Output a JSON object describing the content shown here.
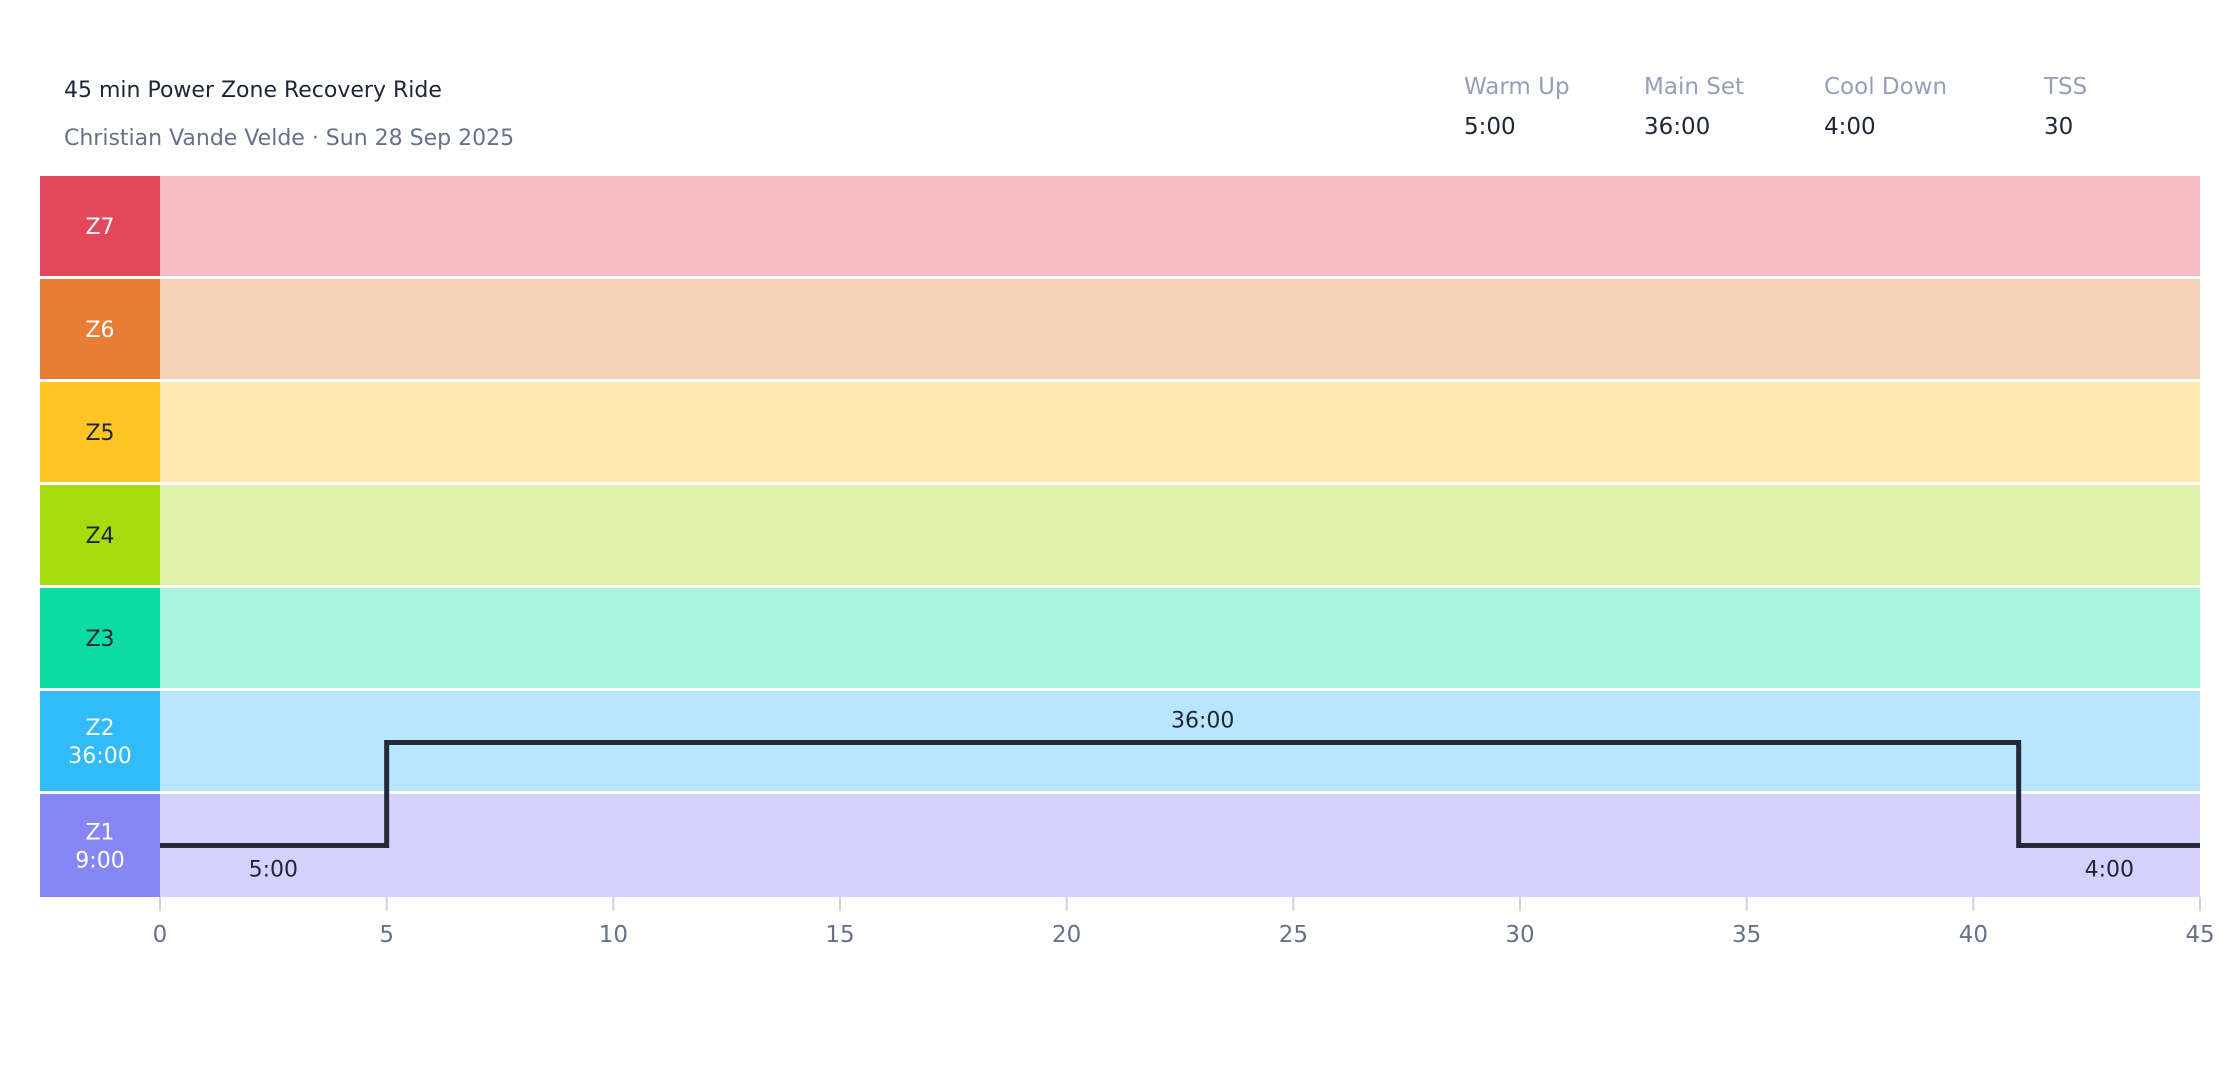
{
  "header": {
    "title": "45 min Power Zone Recovery Ride",
    "subtitle": "Christian Vande Velde · Sun 28 Sep 2025"
  },
  "stats": [
    {
      "label": "Warm Up",
      "value": "5:00"
    },
    {
      "label": "Main Set",
      "value": "36:00"
    },
    {
      "label": "Cool Down",
      "value": "4:00"
    },
    {
      "label": "TSS",
      "value": "30"
    }
  ],
  "chart_data": {
    "type": "step",
    "xlim": [
      0,
      45
    ],
    "x_ticks": [
      0,
      5,
      10,
      15,
      20,
      25,
      30,
      35,
      40,
      45
    ],
    "zones": [
      {
        "name": "Z7",
        "time": "",
        "color": "#e5475a",
        "band": "#f6bcc3",
        "text": "#ffffff"
      },
      {
        "name": "Z6",
        "time": "",
        "color": "#e87d37",
        "band": "#f6d2b9",
        "text": "#ffffff"
      },
      {
        "name": "Z5",
        "time": "",
        "color": "#ffc522",
        "band": "#ffe9af",
        "text": "#1e2636"
      },
      {
        "name": "Z4",
        "time": "",
        "color": "#a8dc0d",
        "band": "#e0f2ac",
        "text": "#1e2636"
      },
      {
        "name": "Z3",
        "time": "",
        "color": "#0ddca2",
        "band": "#aaf3df",
        "text": "#1e2636"
      },
      {
        "name": "Z2",
        "time": "36:00",
        "color": "#31bbf8",
        "band": "#b8e6fc",
        "text": "#ffffff"
      },
      {
        "name": "Z1",
        "time": "9:00",
        "color": "#8686f7",
        "band": "#d4d2fd",
        "text": "#ffffff"
      }
    ],
    "segments": [
      {
        "start": 0,
        "end": 5,
        "zone": 1,
        "label": "5:00"
      },
      {
        "start": 5,
        "end": 41,
        "zone": 2,
        "label": "36:00"
      },
      {
        "start": 41,
        "end": 45,
        "zone": 1,
        "label": "4:00"
      }
    ]
  }
}
